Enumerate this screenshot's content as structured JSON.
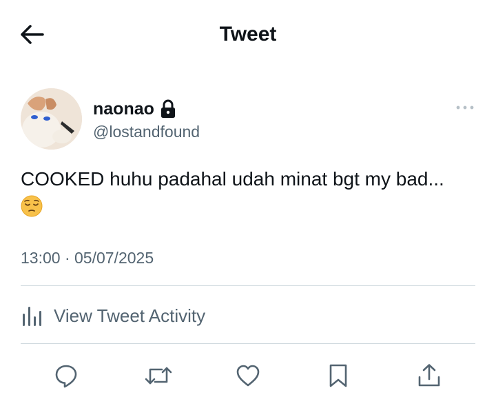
{
  "header": {
    "back_icon": "arrow-left-icon",
    "title": "Tweet"
  },
  "author": {
    "display_name": "naonao",
    "protected_icon": "lock-icon",
    "handle": "@lostandfound",
    "more_icon": "more-horizontal-icon"
  },
  "tweet": {
    "text": "COOKED huhu padahal udah minat bgt my bad...",
    "emoji": "pensive-face-emoji",
    "timestamp": "13:00 · 05/07/2025"
  },
  "activity": {
    "icon": "bar-chart-icon",
    "label": "View Tweet Activity"
  },
  "actions": [
    {
      "icon": "reply-icon"
    },
    {
      "icon": "retweet-icon"
    },
    {
      "icon": "like-icon"
    },
    {
      "icon": "bookmark-icon"
    },
    {
      "icon": "share-icon"
    }
  ],
  "colors": {
    "text_primary": "#0f1419",
    "text_secondary": "#536471",
    "divider": "#cfd9de"
  }
}
